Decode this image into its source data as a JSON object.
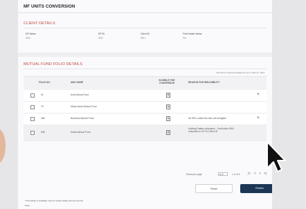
{
  "page": {
    "title": "MF UNITS CONVERSION"
  },
  "client_details": {
    "heading": "CLIENT DETAILS",
    "fields": [
      {
        "label": "DP Name",
        "value": "SNA"
      },
      {
        "label": "DP ID",
        "value": "IN30"
      },
      {
        "label": "Client ID",
        "value": "8441"
      },
      {
        "label": "First Holder Name",
        "value": "SUI"
      }
    ]
  },
  "folio": {
    "heading": "MUTUAL FUND FOLIO DETAILS",
    "note": "The below mentioned details are as on Mar 31, 2023",
    "columns": {
      "folio": "FOLIO NO.",
      "amc": "AMC NAME",
      "eligible": "ELIGIBLE FOR CONVERSION",
      "reason": "REASON FOR INELIGIBILITY"
    },
    "rows": [
      {
        "folio": "91",
        "amc": "Axis Mutual Fund",
        "reason": ""
      },
      {
        "folio": "79",
        "amc": "Mirae Asset Mutual Fund",
        "reason": ""
      },
      {
        "folio": "365",
        "amc": "Bandhan Mutual Fund",
        "reason": "All SIPs under this folio are ineligible"
      },
      {
        "folio": "638",
        "amc": "Kotak Mutual Fund",
        "reason": "Holding Pattern mismatch - 2nd holder PAN mismatch in DP ID-Client ID"
      }
    ]
  },
  "pagination": {
    "rows_per_page_label": "Rows per page",
    "rows_per_page_value": "10",
    "range": "1-4 of 4",
    "first": "|<",
    "prev": "<",
    "next": ">",
    "last": ">|"
  },
  "actions": {
    "reset": "Reset",
    "review": "Review"
  },
  "footer": {
    "footnote": "*The facility is available only for single holding demat account.",
    "note_label": "Note:"
  }
}
